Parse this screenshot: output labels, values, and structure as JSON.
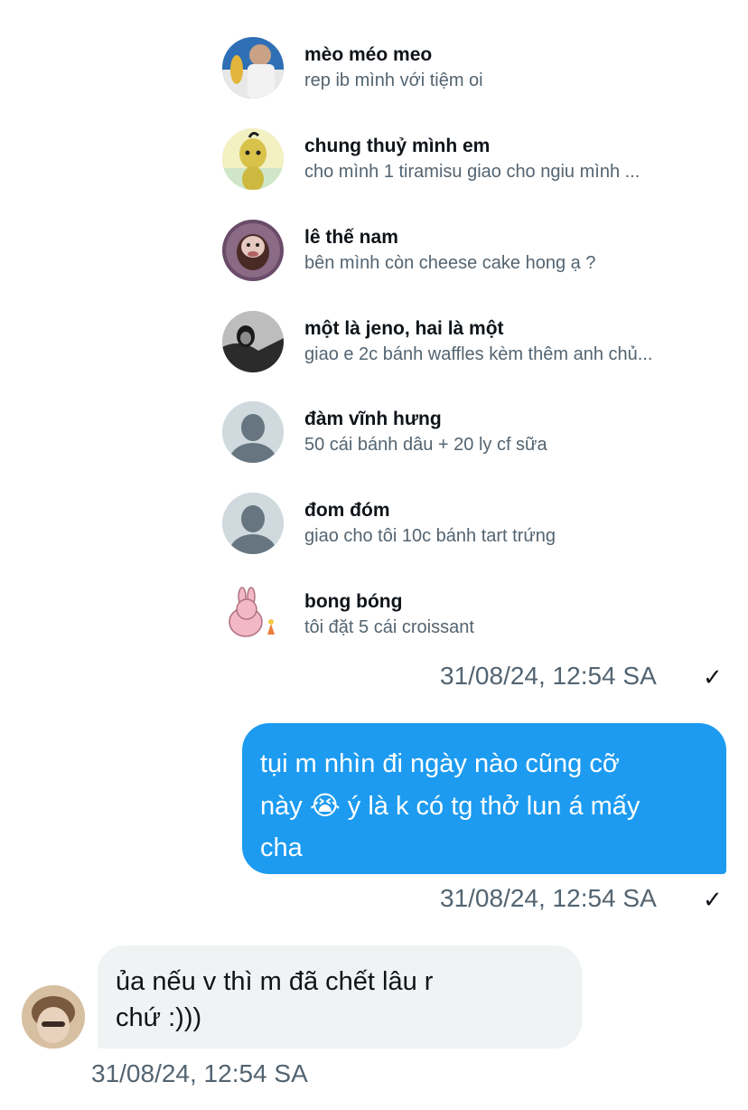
{
  "shared_list": [
    {
      "name": "mèo méo meo",
      "preview": "rep ib mình với tiệm oi",
      "avatar_icon": "profile-photo-man-with-toy"
    },
    {
      "name": "chung thuỷ mình em",
      "preview": " cho mình 1 tiramisu giao cho ngiu mình ...",
      "avatar_icon": "profile-photo-yellow-cartoon"
    },
    {
      "name": "lê thế nam",
      "preview": "bên mình còn cheese cake hong ạ ?",
      "avatar_icon": "profile-photo-dog-face"
    },
    {
      "name": "một là jeno, hai là một",
      "preview": "giao e 2c bánh waffles kèm thêm anh chủ...",
      "avatar_icon": "profile-photo-bw-girl"
    },
    {
      "name": "đàm vĩnh hưng",
      "preview": "50 cái bánh dâu + 20 ly cf sữa",
      "avatar_icon": "default-avatar-icon"
    },
    {
      "name": "đom đóm",
      "preview": "giao cho tôi 10c bánh tart trứng",
      "avatar_icon": "default-avatar-icon"
    },
    {
      "name": "bong bóng",
      "preview": "tôi đặt 5 cái croissant",
      "avatar_icon": "profile-photo-pink-bunny"
    }
  ],
  "messages": {
    "shared_timestamp": "31/08/24, 12:54 SA",
    "outgoing_line1": "tụi m nhìn đi ngày nào cũng cỡ",
    "outgoing_line2_a": "này ",
    "outgoing_emoji": "😭",
    "outgoing_line2_b": " ý là k có tg thở lun á mấy",
    "outgoing_line3": "cha",
    "outgoing_timestamp": "31/08/24, 12:54 SA",
    "incoming_line1": " ủa nếu v thì m đã chết lâu r",
    "incoming_line2": "chứ :)))",
    "incoming_timestamp": "31/08/24, 12:54 SA",
    "read_check": "✓"
  },
  "colors": {
    "accent": "#1d9bf0",
    "muted_text": "#536471",
    "incoming_bubble": "#eff3f4"
  }
}
